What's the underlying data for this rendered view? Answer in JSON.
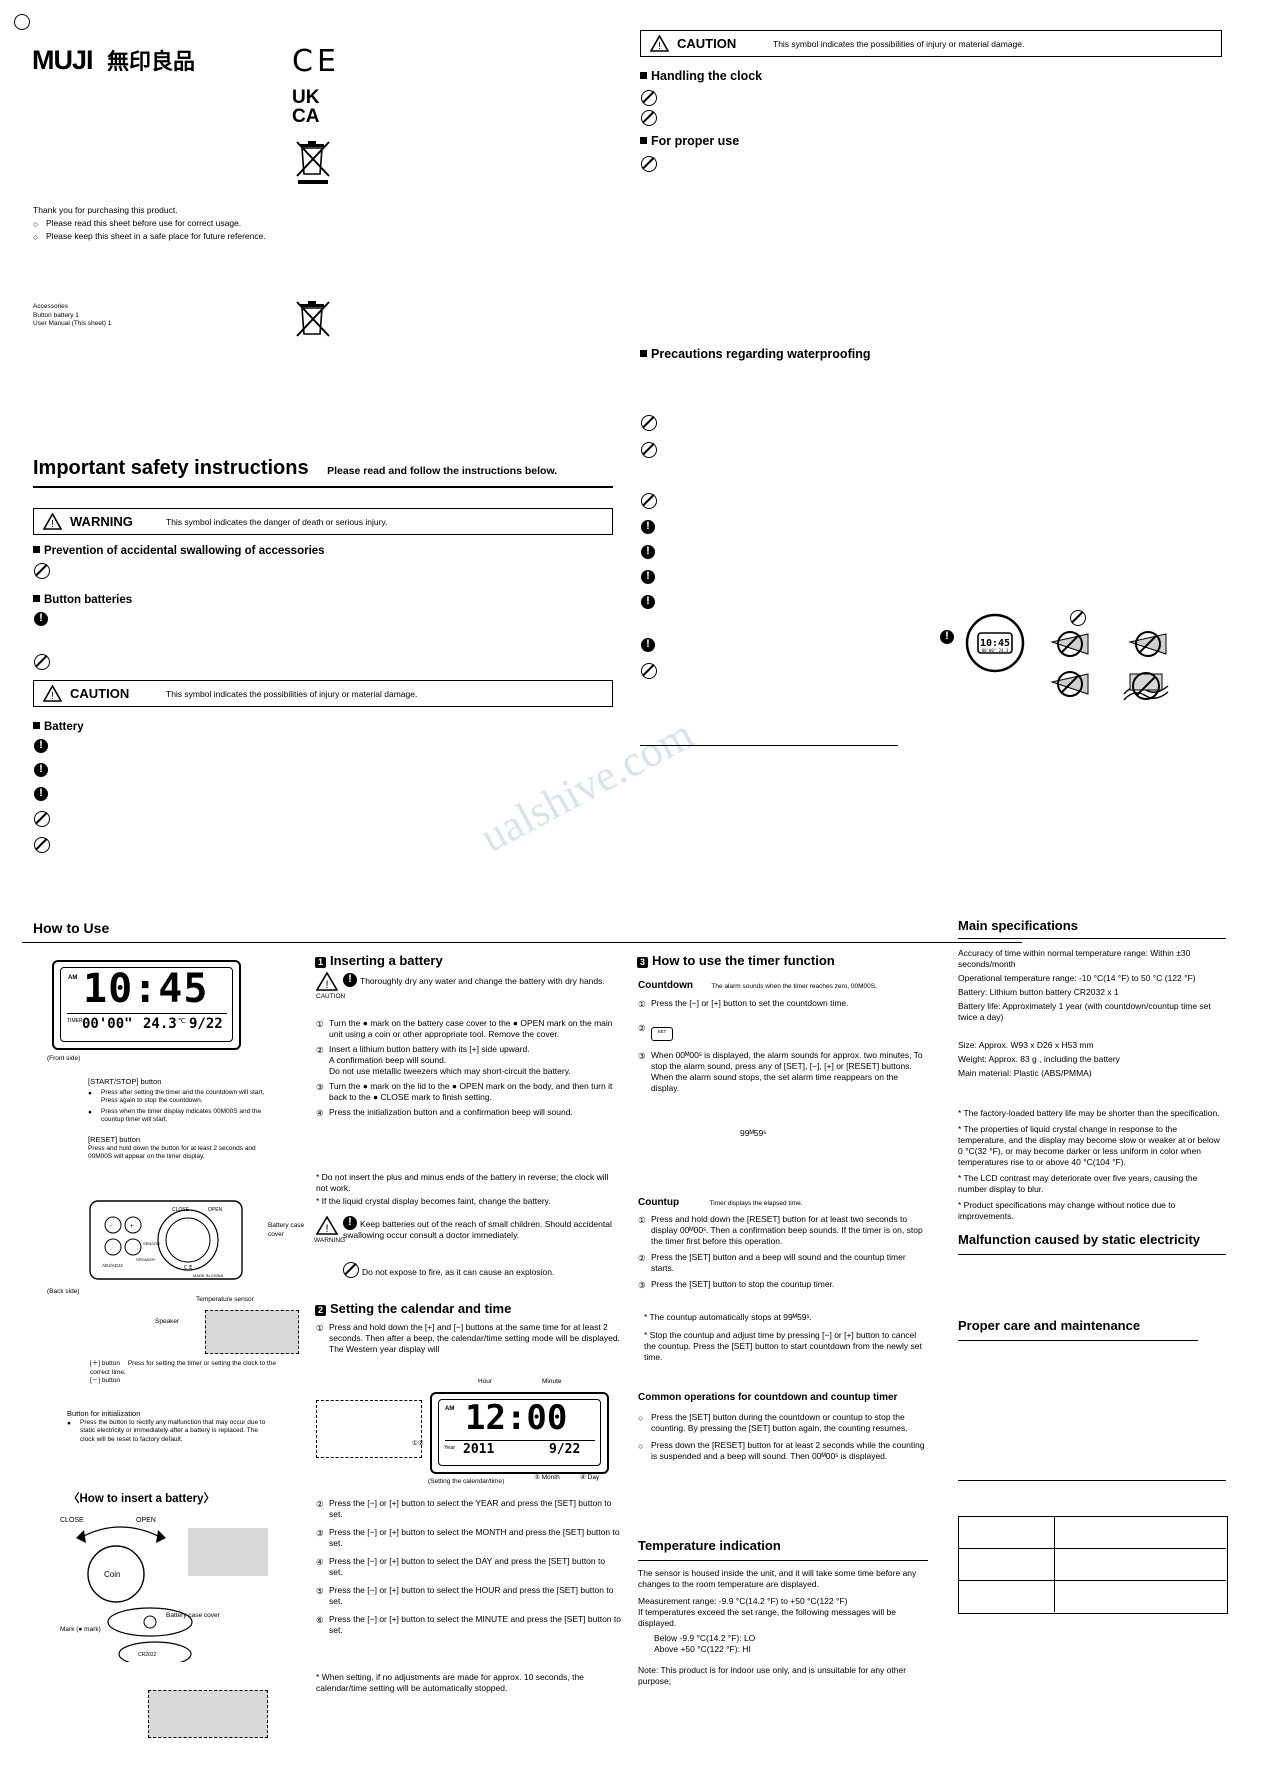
{
  "brand": {
    "logo": "MUJI",
    "jp": "無印良品"
  },
  "marks": {
    "ce": "CE",
    "ukca_top": "UK",
    "ukca_bottom": "CA"
  },
  "intro": {
    "thanks": "Thank you for purchasing this product.",
    "b1": "Please read this sheet before use for correct usage.",
    "b2": "Please keep this sheet in a safe place for future reference.",
    "acc_title": "Accessories",
    "acc1": "Button battery 1",
    "acc2": "User Manual (This sheet) 1"
  },
  "safety": {
    "title": "Important safety instructions",
    "subtitle": "Please read and follow the instructions below.",
    "warning_label": "WARNING",
    "warning_text": "This symbol indicates the danger of death or serious injury.",
    "sec1": "Prevention of accidental swallowing of accessories",
    "sec2": "Button batteries",
    "caution_label": "CAUTION",
    "caution_text": "This symbol indicates the possibilities of injury or material damage.",
    "sec3": "Battery"
  },
  "right_top": {
    "caution_label": "CAUTION",
    "caution_text": "This symbol indicates the possibilities of injury or material damage.",
    "sec1": "Handling the clock",
    "sec2": "For proper use",
    "sec3": "Precautions regarding waterproofing"
  },
  "howto": {
    "title": "How to Use",
    "lcd": {
      "am": "AM",
      "time": "10:45",
      "timer_label": "TIMER",
      "timer": "00'00\"",
      "temp": "24.3",
      "temp_unit": "℃",
      "date": "9/22"
    },
    "front_side": "(Front side)",
    "back_side": "(Back side)",
    "startstop": "[START/STOP] button",
    "startstop_b1": "Press after setting the timer and the countdown will start, Press again to stop the countdown.",
    "startstop_b2": "Press when the timer display indicates 00M00S and the countup timer will start,",
    "reset": "[RESET] button",
    "reset_desc": "Press and hold down the button for at least 2 seconds and 00M00S will appear on the timer display.",
    "battery_cover": "Battery case cover",
    "temp_sensor": "Temperature sensor",
    "speaker": "Speaker",
    "plus_btn": "[＋] button",
    "minus_btn": "[－] button",
    "plusminus_desc": "Press for setting the timer or setting the clock to the correct time,",
    "init_title": "Button for initialization",
    "init_desc": "Press the button to rectify any malfunction that may occur due to static electricity or immediately after a battery is replaced. The clock will be reset to factory default.",
    "insert_title": "〈How to insert a battery〉",
    "close": "CLOSE",
    "open": "OPEN",
    "coin": "Coin",
    "mark": "Mark (● mark)",
    "cover_label": "Battery case cover"
  },
  "step1": {
    "num": "1",
    "title": "Inserting a battery",
    "caution_label": "CAUTION",
    "caution_text": "Thoroughly dry any water and change the battery with dry hands.",
    "items": [
      "Turn the ● mark on the battery case cover to the ● OPEN mark on the main unit using a coin or other appropriate tool. Remove the cover.",
      "Insert a lithium button battery with its [+] side upward.\nA confirmation beep will sound.\nDo not use metallic tweezers which may short-circuit the battery.",
      "Turn the ● mark on the lid to the ● OPEN mark on the body, and then turn it back to the ● CLOSE mark to finish setting.",
      "Press the initialization button and a confirmation beep will sound."
    ],
    "note1": "* Do not insert the plus and minus ends of the battery in reverse; the clock will not work.",
    "note2": "* If the liquid crystal display becomes faint, change the battery.",
    "warn_label": "WARNING",
    "warn1": "Keep batteries out of the reach of small children. Should accidental swallowing occur consult a doctor immediately.",
    "warn2": "Do not expose to fire, as it can cause an explosion."
  },
  "step2": {
    "num": "2",
    "title": "Setting the calendar and time",
    "p1": "Press and hold down the [+] and [−] buttons at the same time for at least 2 seconds. Then after a beep, the calendar/time setting mode will be displayed. The Western year display will",
    "lcd": {
      "am": "AM",
      "time": "12:00",
      "year_label": "Year",
      "year": "2011",
      "md": "9/22",
      "hour_label": "Hour",
      "min_label": "Minute",
      "month_label": "Month",
      "day_label": "Day",
      "marks": "①②"
    },
    "lcd_caption": "(Setting the calendar/time)",
    "steps": [
      "Press the [−] or [+] button to select the YEAR and press the [SET] button to set.",
      "Press the [−] or [+] button to select the MONTH and press the [SET] button to set.",
      "Press the [−] or [+] button to select the DAY and press the [SET] button to set.",
      "Press the [−] or [+] button to select the HOUR and press the [SET] button to set.",
      "Press the [−] or [+] button to select the MINUTE and press the [SET] button to set."
    ],
    "note": "* When setting, if no adjustments are made for approx. 10 seconds, the calendar/time setting will be automatically stopped."
  },
  "step3": {
    "num": "3",
    "title": "How to use the timer function",
    "countdown_label": "Countdown",
    "countdown_sub": "The alarm sounds when the timer reaches zero, 00M00S.",
    "cd1": "Press the [−] or [+] button to set the countdown time.",
    "cd3": "When 00ᴹ00ˢ is displayed, the alarm sounds for approx. two minutes, To stop the alarm sound, press any of [SET], [−], [+] or [RESET] buttons. When the alarm sound stops, the set alarm time reappears on the display.",
    "cd_display": "99ᴹ59ˢ",
    "countup_label": "Countup",
    "countup_sub": "Timer displays the elapsed time.",
    "cu1": "Press and hold down the [RESET] button for at least two seconds to display 00ᴹ00ˢ. Then a confirmation beep sounds. If the timer is on, stop the timer first before this operation.",
    "cu2": "Press the [SET] button and a beep will sound and the countup timer starts.",
    "cu3": "Press the [SET] button to stop the countup timer.",
    "cu_note1": "* The countup automatically stops at 99ᴹ59ˢ.",
    "cu_note2": "* Stop the countup and adjust time by pressing [−] or [+] button to cancel the countup. Press the [SET] button to start countdown from the newly set time.",
    "common_title": "Common operations for countdown and countup timer",
    "com1": "Press the [SET] button during the countdown or countup to stop the counting. By pressing the [SET] button again, the counting resumes.",
    "com2": "Press down the [RESET] button for at least 2 seconds while the counting is suspended and a beep will sound. Then 00ᴹ00ˢ is displayed."
  },
  "temperature": {
    "title": "Temperature indication",
    "p1": "The sensor is housed inside the unit, and it will take some time before any changes to the room temperature are displayed.",
    "p2": "Measurement range: -9.9 °C(14.2 °F) to +50 °C(122 °F)",
    "p3": "If temperatures exceed the set range, the following messages will be displayed.",
    "p4": "Below -9.9 °C(14.2 °F):  LO",
    "p5": "Above +50 °C(122 °F):   HI",
    "note": "Note: This product is for indoor use only, and is unsuitable for any other purpose;"
  },
  "specs": {
    "title": "Main specifications",
    "lines": [
      "Accuracy of time within normal temperature range: Within ±30 seconds/month",
      "Operational temperature range: -10 °C(14 °F) to 50 °C (122 °F)",
      "Battery: Lithium button battery CR2032 x 1",
      "Battery life: Approximately 1 year (with countdown/countup time set twice a day)"
    ],
    "lines2": [
      "Size: Approx. W93 x D26 x H53 mm",
      "Weight: Approx. 83 g            , including the battery",
      "Main material: Plastic (ABS/PMMA)"
    ],
    "notes": [
      "* The factory-loaded battery life may be shorter than the specification.",
      "* The properties of liquid crystal change in response to the temperature, and the display may become slow or weaker at or below 0 °C(32 °F), or may become darker or less uniform in color when temperatures rise to or above 40 °C(104 °F).",
      "* The LCD contrast may deteriorate over five years, causing the number display to blur.",
      "* Product specifications may change without notice due to improvements."
    ],
    "static_title": "Malfunction caused by static electricity",
    "care_title": "Proper care and maintenance"
  },
  "watermark": "ualshive.com"
}
